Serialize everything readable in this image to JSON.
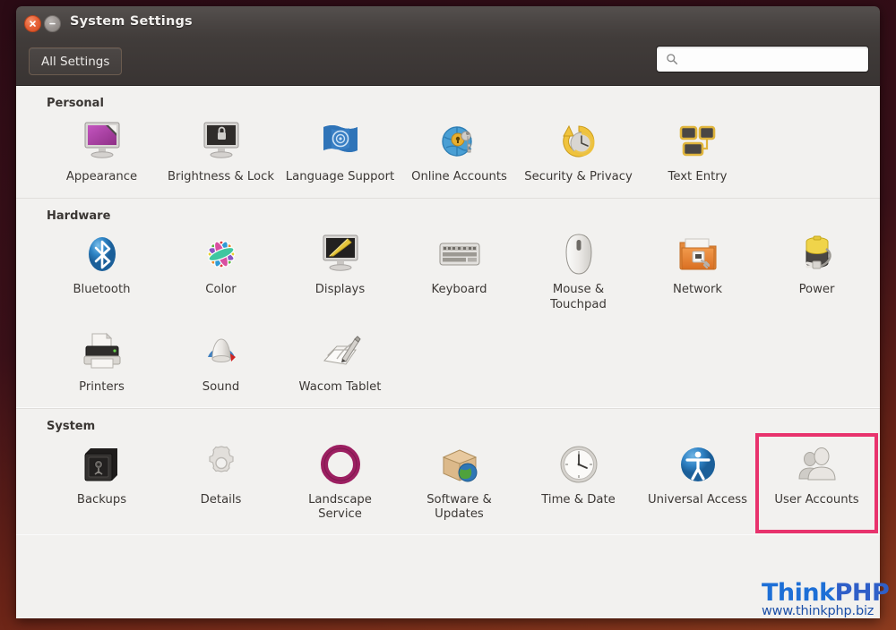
{
  "window": {
    "title": "System Settings",
    "close_icon": "close-icon",
    "minimize_icon": "minimize-icon"
  },
  "toolbar": {
    "all_settings_label": "All Settings",
    "search_icon": "search-icon",
    "search_value": "",
    "search_placeholder": ""
  },
  "sections": [
    {
      "title": "Personal",
      "items": [
        {
          "label": "Appearance",
          "icon": "appearance-icon",
          "selected": false
        },
        {
          "label": "Brightness & Lock",
          "icon": "brightness-lock-icon",
          "selected": false
        },
        {
          "label": "Language Support",
          "icon": "language-support-icon",
          "selected": false
        },
        {
          "label": "Online Accounts",
          "icon": "online-accounts-icon",
          "selected": false
        },
        {
          "label": "Security & Privacy",
          "icon": "security-privacy-icon",
          "selected": false
        },
        {
          "label": "Text Entry",
          "icon": "text-entry-icon",
          "selected": false
        }
      ]
    },
    {
      "title": "Hardware",
      "items": [
        {
          "label": "Bluetooth",
          "icon": "bluetooth-icon",
          "selected": false
        },
        {
          "label": "Color",
          "icon": "color-icon",
          "selected": false
        },
        {
          "label": "Displays",
          "icon": "displays-icon",
          "selected": false
        },
        {
          "label": "Keyboard",
          "icon": "keyboard-icon",
          "selected": false
        },
        {
          "label": "Mouse & Touchpad",
          "icon": "mouse-touchpad-icon",
          "selected": false
        },
        {
          "label": "Network",
          "icon": "network-icon",
          "selected": false
        },
        {
          "label": "Power",
          "icon": "power-icon",
          "selected": false
        },
        {
          "label": "Printers",
          "icon": "printers-icon",
          "selected": false
        },
        {
          "label": "Sound",
          "icon": "sound-icon",
          "selected": false
        },
        {
          "label": "Wacom Tablet",
          "icon": "wacom-tablet-icon",
          "selected": false
        }
      ]
    },
    {
      "title": "System",
      "items": [
        {
          "label": "Backups",
          "icon": "backups-icon",
          "selected": false
        },
        {
          "label": "Details",
          "icon": "details-icon",
          "selected": false
        },
        {
          "label": "Landscape Service",
          "icon": "landscape-service-icon",
          "selected": false
        },
        {
          "label": "Software & Updates",
          "icon": "software-updates-icon",
          "selected": false
        },
        {
          "label": "Time & Date",
          "icon": "time-date-icon",
          "selected": false
        },
        {
          "label": "Universal Access",
          "icon": "universal-access-icon",
          "selected": false
        },
        {
          "label": "User Accounts",
          "icon": "user-accounts-icon",
          "selected": true
        }
      ]
    }
  ],
  "watermark": {
    "brand_first": "Think",
    "brand_second": "PHP",
    "url": "www.thinkphp.biz"
  },
  "colors": {
    "selection_highlight": "#e8336d",
    "titlebar": "#494442",
    "content_background": "#f2f1ef",
    "watermark_blue": "#1d6fd6"
  }
}
